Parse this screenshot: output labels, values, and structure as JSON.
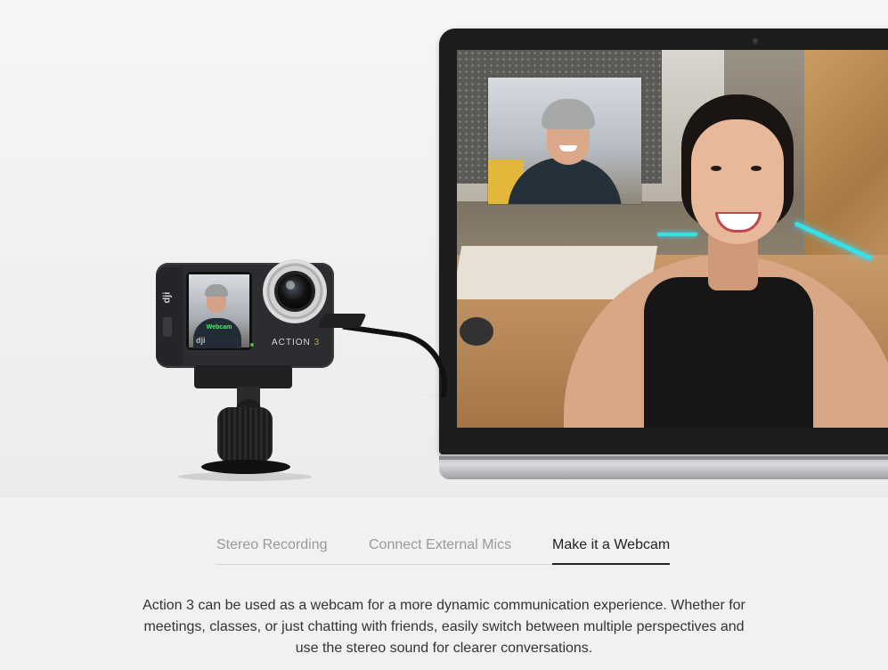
{
  "hero": {
    "camera": {
      "side_logo": "dji",
      "screen_label": "Webcam",
      "small_logo": "dji",
      "brand_text": "ACTION",
      "brand_number": "3"
    }
  },
  "tabs": [
    {
      "label": "Stereo Recording",
      "active": false
    },
    {
      "label": "Connect External Mics",
      "active": false
    },
    {
      "label": "Make it a Webcam",
      "active": true
    }
  ],
  "description": "Action 3 can be used as a webcam for a more dynamic communication experience. Whether for meetings, classes, or just chatting with friends, easily switch between multiple perspectives and use the stereo sound for clearer conversations.",
  "colors": {
    "active_tab": "#222222",
    "inactive_tab": "#9a9a9a",
    "background": "#f1f1f1"
  }
}
